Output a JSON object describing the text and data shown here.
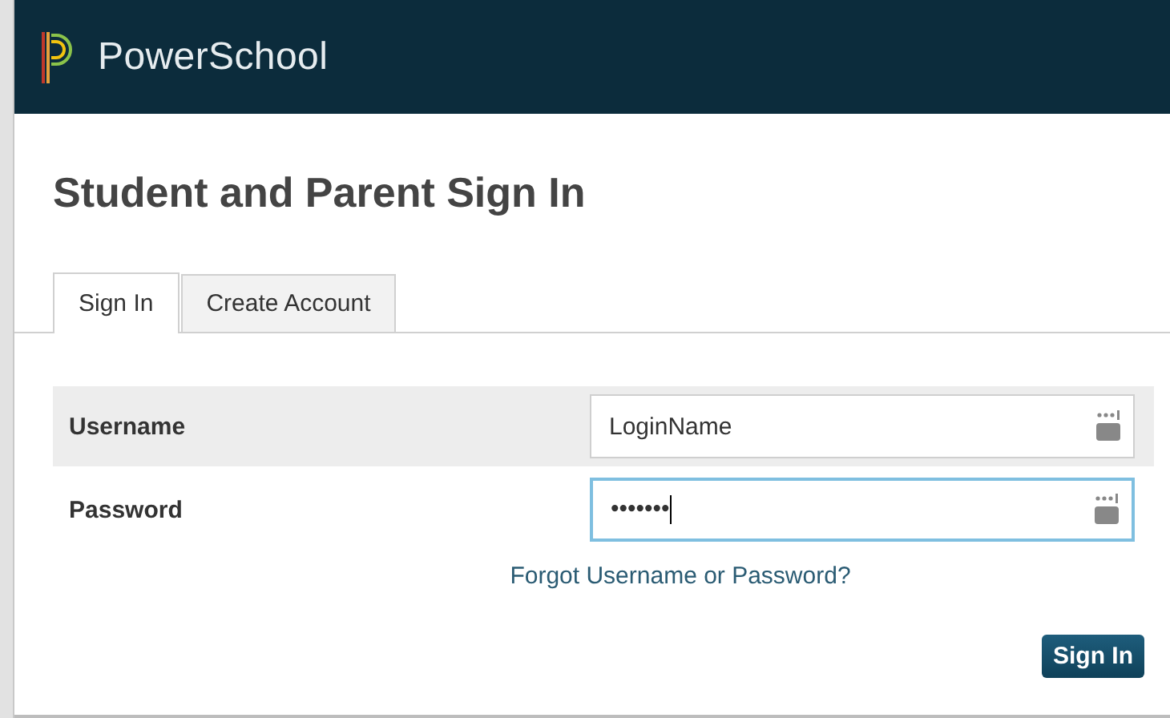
{
  "header": {
    "brand": "PowerSchool"
  },
  "title": "Student and Parent Sign In",
  "tabs": [
    {
      "label": "Sign In",
      "selected": true
    },
    {
      "label": "Create Account",
      "selected": false
    }
  ],
  "fields": [
    {
      "label": "Username",
      "value": "LoginName",
      "focused": false
    },
    {
      "label": "Password",
      "value": "•••••••",
      "focused": true
    }
  ],
  "forgot_link": "Forgot Username or Password?",
  "submit": "Sign In"
}
